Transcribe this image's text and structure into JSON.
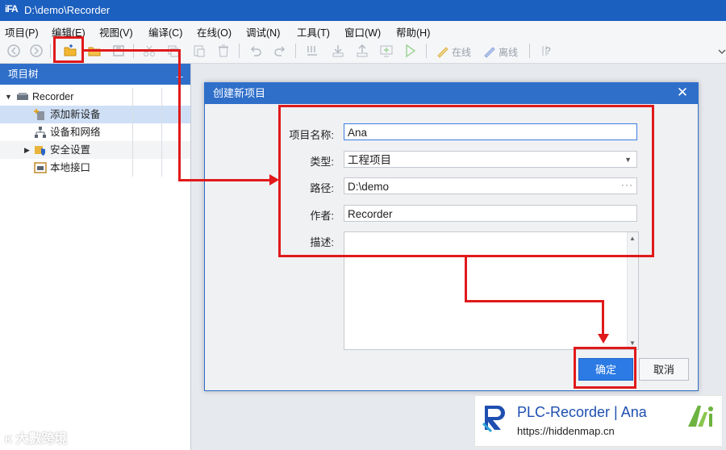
{
  "window": {
    "logo_text": "iFA",
    "title": "D:\\demo\\Recorder"
  },
  "menu": [
    "项目(P)",
    "编辑(E)",
    "视图(V)",
    "编译(C)",
    "在线(O)",
    "调试(N)",
    "工具(T)",
    "窗口(W)",
    "帮助(H)"
  ],
  "toolbar": {
    "online_label": "在线",
    "offline_label": "离线",
    "help_label": "?"
  },
  "project_tree": {
    "header": "项目树",
    "pin": "⊥",
    "root": "Recorder",
    "items": [
      "添加新设备",
      "设备和网络",
      "安全设置",
      "本地接口"
    ]
  },
  "dialog": {
    "title": "创建新项目",
    "close": "✕",
    "fields": {
      "name": {
        "label": "项目名称:",
        "value": "Ana"
      },
      "type": {
        "label": "类型:",
        "value": "工程项目"
      },
      "path": {
        "label": "路径:",
        "value": "D:\\demo"
      },
      "author": {
        "label": "作者:",
        "value": "Recorder"
      },
      "desc": {
        "label": "描述:",
        "value": ""
      }
    },
    "ok": "确定",
    "cancel": "取消"
  },
  "watermark": "大數跨境",
  "banner": {
    "title": "PLC-Recorder | Ana",
    "url": "https://hiddenmap.cn",
    "ai_mark": "Ai"
  },
  "colors": {
    "title_bar": "#1b5fbf",
    "panel_header": "#2f6fca",
    "accent": "#2c7be5",
    "highlight": "#e0191b"
  }
}
